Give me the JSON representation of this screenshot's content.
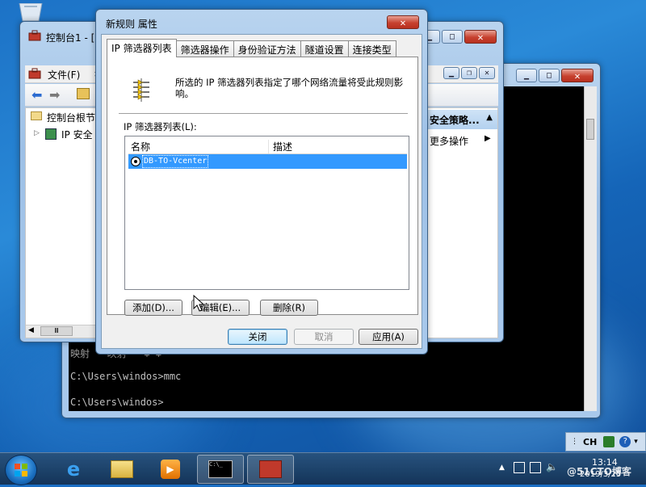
{
  "desktop": {
    "recycle_icon": "recycle-bin-icon"
  },
  "mmc_window": {
    "title": "控制台1 - [",
    "menu": {
      "file": "文件(F)",
      "next": "操"
    },
    "tree": {
      "root": "控制台根节",
      "child": "IP 安全"
    },
    "actions": {
      "header": "安全策略...",
      "more": "更多操作"
    },
    "hscroll": "Ⅲ"
  },
  "cmd_window": {
    "partial_line": "  映射       \" 映射       \"  ∓ ∓ ·  ",
    "line1": "C:\\Users\\windos>mmc",
    "line2": "C:\\Users\\windos>"
  },
  "dialog": {
    "title": "新规则 属性",
    "tabs": [
      "IP 筛选器列表",
      "筛选器操作",
      "身份验证方法",
      "隧道设置",
      "连接类型"
    ],
    "description": "所选的 IP 筛选器列表指定了哪个网络流量将受此规则影响。",
    "list_label": "IP 筛选器列表(L):",
    "columns": {
      "name": "名称",
      "description": "描述"
    },
    "rows": [
      {
        "name": "DB-TO-Vcenter",
        "selected": true
      }
    ],
    "buttons": {
      "add": "添加(D)...",
      "edit": "编辑(E)...",
      "remove": "删除(R)"
    },
    "footer": {
      "ok": "关闭",
      "cancel": "取消",
      "apply": "应用(A)"
    }
  },
  "language_bar": {
    "lang": "CH"
  },
  "taskbar": {
    "clock_time": "13:14",
    "clock_date": "2019/3/25",
    "watermark": "@51CTO博客"
  }
}
